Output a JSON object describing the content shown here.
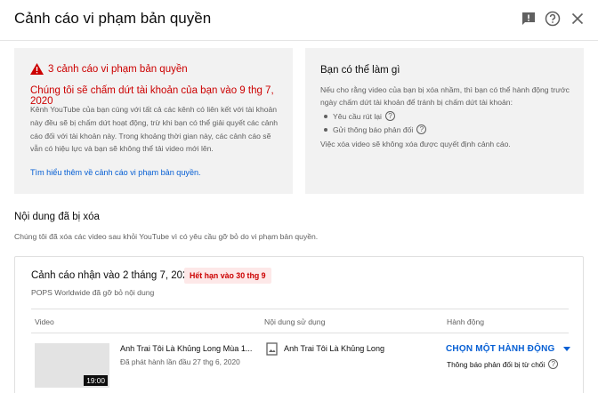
{
  "header": {
    "title": "Cảnh cáo vi phạm bản quyền",
    "icons": [
      "feedback-icon",
      "help-icon",
      "close-icon"
    ]
  },
  "warning_card": {
    "title": "3 cảnh cáo vi phạm bản quyền",
    "termination": "Chúng tôi sẽ chấm dứt tài khoản của bạn vào 9 thg 7, 2020",
    "body": "Kênh YouTube của bạn cùng với tất cả các kênh có liên kết với tài khoản này đều sẽ bị chấm dứt hoạt động, trừ khi bạn có thể giải quyết các cảnh cáo đối với tài khoản này. Trong khoảng thời gian này, các cảnh cáo sẽ vẫn có hiệu lực và bạn sẽ không thể tải video mới lên.",
    "link": "Tìm hiểu thêm về cảnh cáo vi phạm bản quyền.",
    "accent": "#cc0000"
  },
  "options_card": {
    "title": "Bạn có thể làm gì",
    "body": "Nếu cho rằng video của bạn bị xóa nhầm, thì bạn có thể hành động trước ngày chấm dứt tài khoản để tránh bị chấm dứt tài khoản:",
    "options": [
      "Yêu cầu rút lại",
      "Gửi thông báo phản đối"
    ],
    "footer": "Việc xóa video sẽ không xóa được quyết định cảnh cáo."
  },
  "removed_section": {
    "title": "Nội dung đã bị xóa",
    "description": "Chúng tôi đã xóa các video sau khỏi YouTube vì có yêu cầu gỡ bỏ do vi phạm bản quyền."
  },
  "strike": {
    "title": "Cảnh cáo nhận vào 2 tháng 7, 2020",
    "expires": "Hết hạn vào 30 thg 9",
    "claimant": "POPS Worldwide đã gỡ bỏ nội dung",
    "columns": {
      "video": "Video",
      "content": "Nội dung sử dụng",
      "action": "Hành động"
    },
    "row": {
      "duration": "19:00",
      "video_title": "Anh Trai Tôi Là Khủng Long Mùa 1...",
      "published": "Đã phát hành lần đầu 27 thg 6, 2020",
      "content_name": "Anh Trai Tôi Là Khủng Long",
      "action_label": "CHỌN MỘT HÀNH ĐỘNG",
      "action_status": "Thông báo phản đối bị từ chối"
    },
    "link_color": "#065fd4"
  }
}
